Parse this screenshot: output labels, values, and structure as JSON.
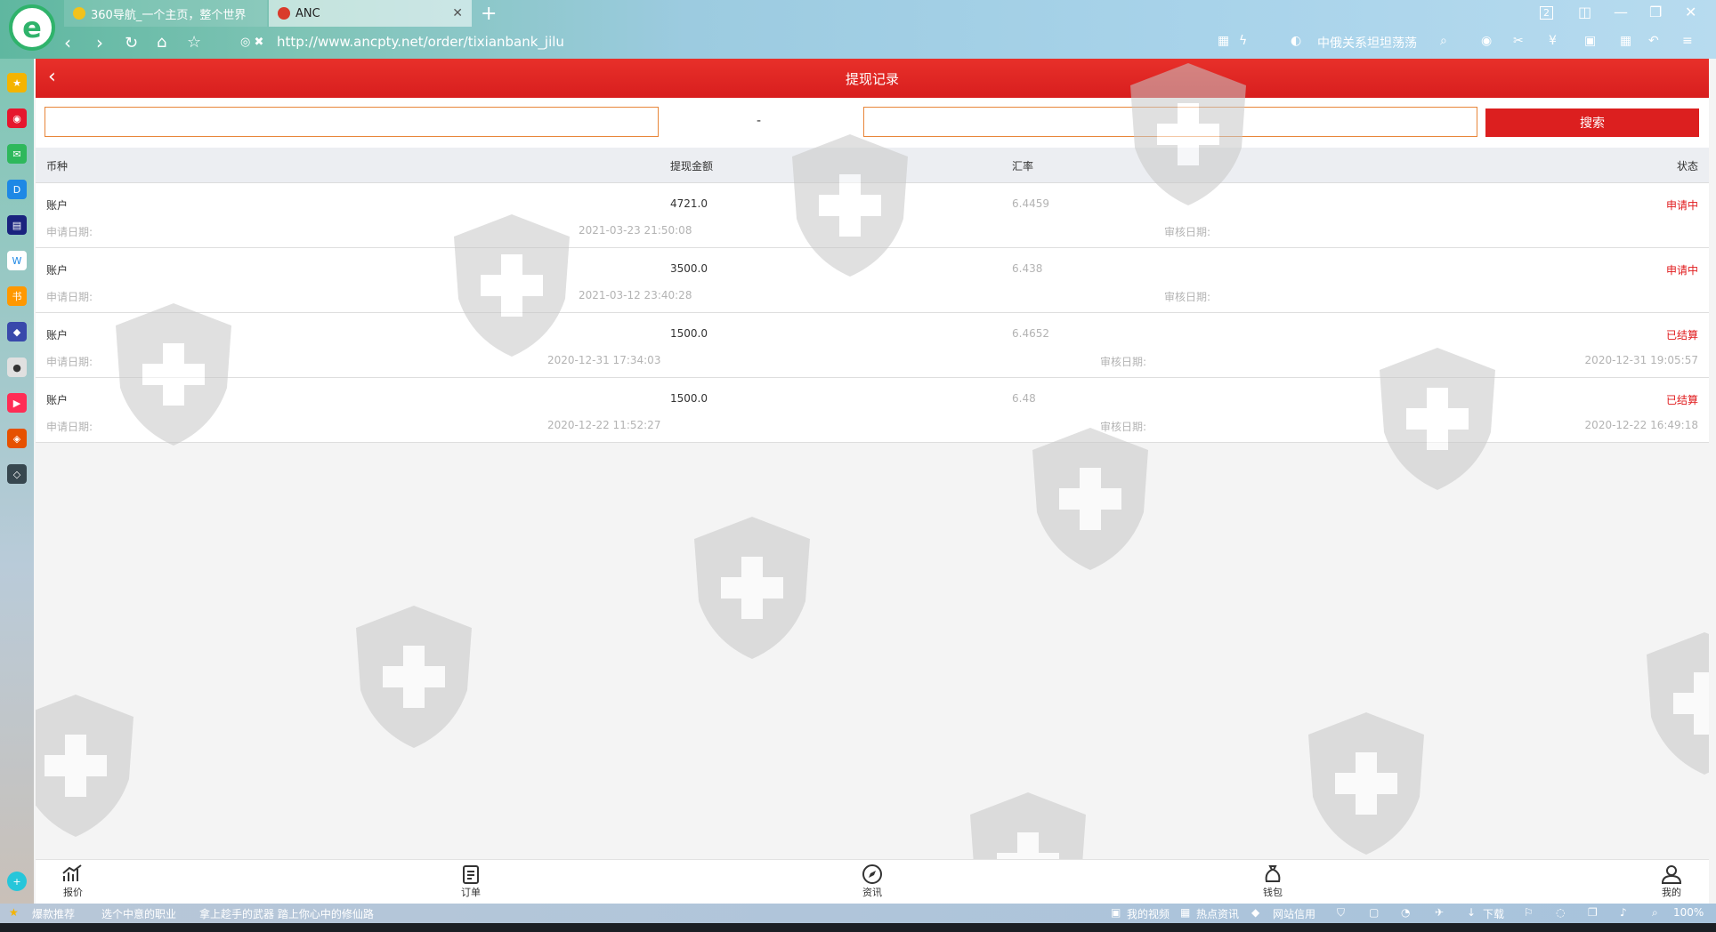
{
  "browser": {
    "tabs": [
      {
        "label": "360导航_一个主页，整个世界"
      },
      {
        "label": "ANC"
      }
    ],
    "url": "http://www.ancpty.net/order/tixianbank_jilu",
    "search_hint": "中俄关系坦坦荡荡",
    "tab_count": "2"
  },
  "page": {
    "title": "提现记录",
    "date_separator": "-",
    "search_button": "搜索"
  },
  "table": {
    "headers": {
      "currency": "币种",
      "amount": "提现金额",
      "rate": "汇率",
      "status": "状态"
    },
    "apply_label": "申请日期:",
    "review_label": "审核日期:",
    "rows": [
      {
        "account": "账户",
        "amount": "4721.0",
        "rate": "6.4459",
        "status": "申请中",
        "apply_date": "2021-03-23 21:50:08",
        "review_date": ""
      },
      {
        "account": "账户",
        "amount": "3500.0",
        "rate": "6.438",
        "status": "申请中",
        "apply_date": "2021-03-12 23:40:28",
        "review_date": ""
      },
      {
        "account": "账户",
        "amount": "1500.0",
        "rate": "6.4652",
        "status": "已结算",
        "apply_date": "2020-12-31 17:34:03",
        "review_date": "2020-12-31 19:05:57"
      },
      {
        "account": "账户",
        "amount": "1500.0",
        "rate": "6.48",
        "status": "已结算",
        "apply_date": "2020-12-22 11:52:27",
        "review_date": "2020-12-22 16:49:18"
      }
    ]
  },
  "tabbar": {
    "items": [
      {
        "label": "报价",
        "icon": "chart-icon"
      },
      {
        "label": "订单",
        "icon": "clipboard-icon"
      },
      {
        "label": "资讯",
        "icon": "compass-icon"
      },
      {
        "label": "钱包",
        "icon": "moneybag-icon"
      },
      {
        "label": "我的",
        "icon": "user-icon"
      }
    ]
  },
  "statusbar": {
    "recommend": "爆款推荐",
    "promo1": "选个中意的职业",
    "promo2": "拿上趁手的武器 踏上你心中的修仙路",
    "my_video": "我的视频",
    "hot_news": "热点资讯",
    "credit": "网站信用",
    "download": "下载",
    "zoom": "100%"
  },
  "colors": {
    "header_red": "#dc1f1f",
    "status_red": "#e0191b",
    "field_border": "#e8863a"
  }
}
